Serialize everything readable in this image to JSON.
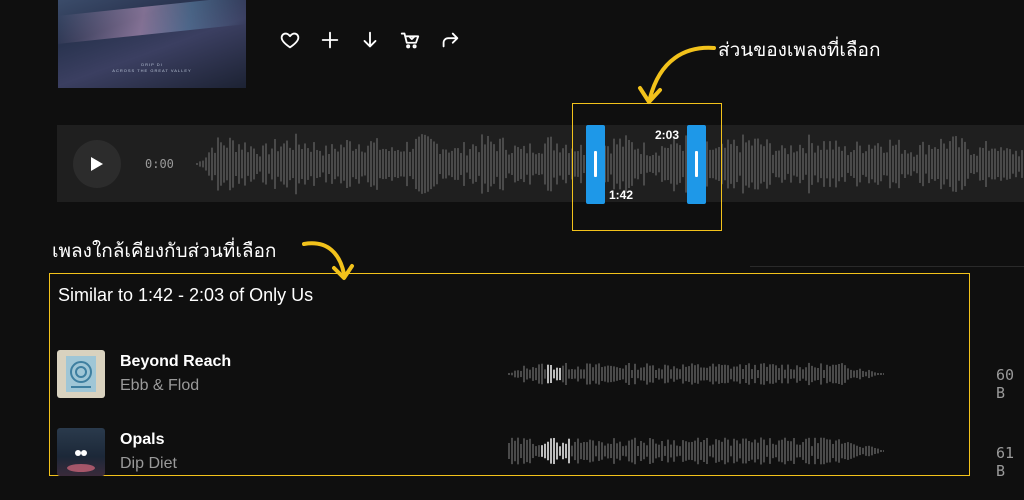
{
  "header": {
    "album_art": {
      "caption_line1": "DRIP DI",
      "caption_line2": "ACROSS THE GREAT VALLEY"
    },
    "actions": [
      {
        "name": "like-button",
        "icon": "heart-icon"
      },
      {
        "name": "add-button",
        "icon": "plus-icon"
      },
      {
        "name": "download-button",
        "icon": "arrow-down-icon"
      },
      {
        "name": "cart-button",
        "icon": "cart-icon"
      },
      {
        "name": "share-button",
        "icon": "share-icon"
      }
    ]
  },
  "player": {
    "current_time": "0:00",
    "selection_start": "1:42",
    "selection_end": "2:03"
  },
  "annotations": {
    "selection_label": "ส่วนของเพลงที่เลือก",
    "similar_label": "เพลงใกล้เคียงกับส่วนที่เลือก"
  },
  "similar": {
    "title": "Similar to 1:42 - 2:03 of Only Us",
    "tracks": [
      {
        "title": "Beyond Reach",
        "artist": "Ebb & Flod",
        "bpm": "60 B"
      },
      {
        "title": "Opals",
        "artist": "Dip Diet",
        "bpm": "61 B"
      }
    ]
  },
  "colors": {
    "accent_blue": "#1e98e8",
    "annotation_yellow": "#f2c21b",
    "background": "#0f0f0f",
    "waveform": "#4a4a4a",
    "waveform_highlight": "#bdbdbd"
  }
}
